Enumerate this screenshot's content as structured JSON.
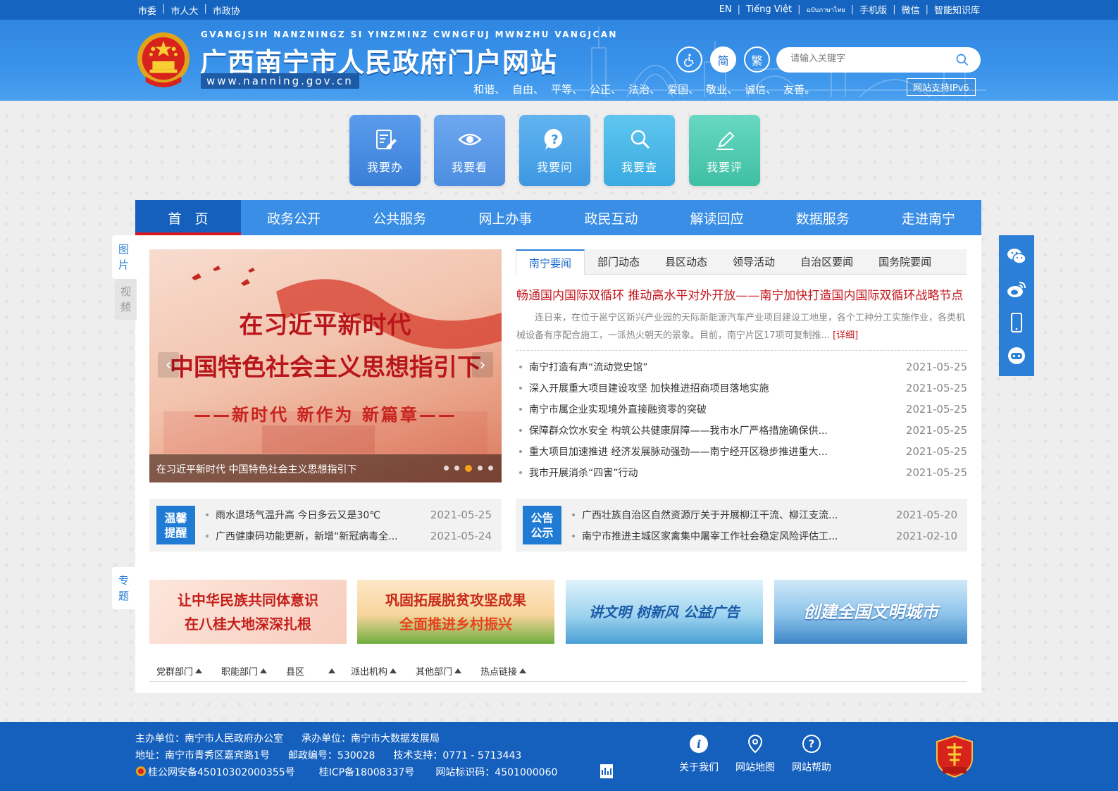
{
  "topbar": {
    "left": [
      "市委",
      "市人大",
      "市政协"
    ],
    "right": [
      "EN",
      "Tiếng Việt",
      "ฉบับภาษาไทย",
      "手机版",
      "微信",
      "智能知识库"
    ]
  },
  "header": {
    "pinyin": "GVANGJSIH NANZNINGZ SI YINZMINZ CWNGFUJ MWNZHU VANGJCAN",
    "title": "广西南宁市人民政府门户网站",
    "url": "www.nanning.gov.cn",
    "simp_label": "简",
    "trad_label": "繁",
    "search_placeholder": "请输入关键字",
    "values": [
      "和谐、",
      "自由、",
      "平等、",
      "公正、",
      "法治、",
      "爱国、",
      "敬业、",
      "诚信、",
      "友善。"
    ],
    "ipv6": "网站支持IPv6"
  },
  "tiles": [
    {
      "label": "我要办",
      "icon": "form-edit-icon",
      "color": "#4a8fe6"
    },
    {
      "label": "我要看",
      "icon": "eye-icon",
      "color": "#5c9de8"
    },
    {
      "label": "我要问",
      "icon": "question-icon",
      "color": "#4fa9ea"
    },
    {
      "label": "我要查",
      "icon": "search-icon",
      "color": "#47b7e6"
    },
    {
      "label": "我要评",
      "icon": "pencil-icon",
      "color": "#4fc7ae"
    }
  ],
  "nav": [
    "首　页",
    "政务公开",
    "公共服务",
    "网上办事",
    "政民互动",
    "解读回应",
    "数据服务",
    "走进南宁"
  ],
  "side_tabs": {
    "image": [
      "图",
      "片"
    ],
    "video": [
      "视",
      "频"
    ],
    "special": [
      "专",
      "题"
    ]
  },
  "carousel": {
    "line1": "在习近平新时代",
    "line2": "中国特色社会主义思想指引下",
    "line3": "——新时代  新作为  新篇章——",
    "caption": "在习近平新时代 中国特色社会主义思想指引下",
    "slide_count": 5,
    "active_slide": 3
  },
  "news": {
    "tabs": [
      "南宁要闻",
      "部门动态",
      "县区动态",
      "领导活动",
      "自治区要闻",
      "国务院要闻"
    ],
    "headline": "畅通国内国际双循环 推动高水平对外开放——南宁加快打造国内国际双循环战略节点",
    "summary": "连日来，在位于邕宁区新兴产业园的天际新能源汽车产业项目建设工地里，各个工种分工实施作业，各类机械设备有序配合施工，一派热火朝天的景象。目前，南宁片区17项可复制推...",
    "more": "[详细]",
    "items": [
      {
        "title": "南宁打造有声“流动党史馆”",
        "date": "2021-05-25"
      },
      {
        "title": "深入开展重大项目建设攻坚 加快推进招商项目落地实施",
        "date": "2021-05-25"
      },
      {
        "title": "南宁市属企业实现境外直接融资零的突破",
        "date": "2021-05-25"
      },
      {
        "title": "保障群众饮水安全 构筑公共健康屏障——我市水厂严格措施确保供...",
        "date": "2021-05-25"
      },
      {
        "title": "重大项目加速推进 经济发展脉动强劲——南宁经开区稳步推进重大...",
        "date": "2021-05-25"
      },
      {
        "title": "我市开展消杀“四害”行动",
        "date": "2021-05-25"
      }
    ]
  },
  "reminder": {
    "badge": [
      "温馨",
      "提醒"
    ],
    "items": [
      {
        "title": "雨水退场气温升高 今日多云又是30℃",
        "date": "2021-05-25"
      },
      {
        "title": "广西健康码功能更新，新增“新冠病毒全...",
        "date": "2021-05-24"
      }
    ]
  },
  "announce": {
    "badge": [
      "公告",
      "公示"
    ],
    "items": [
      {
        "title": "广西壮族自治区自然资源厅关于开展柳江干流、柳江支流...",
        "date": "2021-05-20"
      },
      {
        "title": "南宁市推进主城区家禽集中屠宰工作社会稳定风险评估工...",
        "date": "2021-02-10"
      }
    ]
  },
  "banners": [
    {
      "lines": [
        "让中华民族共同体意识",
        "在八桂大地深深扎根"
      ]
    },
    {
      "lines": [
        "巩固拓展脱贫攻坚成果",
        "全面推进乡村振兴"
      ]
    },
    {
      "lines": [
        "讲文明 树新风 公益广告"
      ]
    },
    {
      "lines": [
        "创建全国文明城市"
      ]
    }
  ],
  "links": [
    "党群部门",
    "职能部门",
    "县区",
    "派出机构",
    "其他部门",
    "热点链接"
  ],
  "footer": {
    "host": "主办单位：南宁市人民政府办公室",
    "operator": "承办单位：南宁市大数据发展局",
    "address": "地址：南宁市青秀区嘉宾路1号",
    "postcode": "邮政编号：530028",
    "support": "技术支持：0771 - 5713443",
    "police": "桂公网安备45010302000355号",
    "icp": "桂ICP备18008337号",
    "site_id": "网站标识码：4501000060",
    "buttons": [
      "关于我们",
      "网站地图",
      "网站帮助"
    ]
  },
  "colors": {
    "primary": "#2b7fd6",
    "nav_active": "#1560bd",
    "headline_red": "#c4171e"
  }
}
